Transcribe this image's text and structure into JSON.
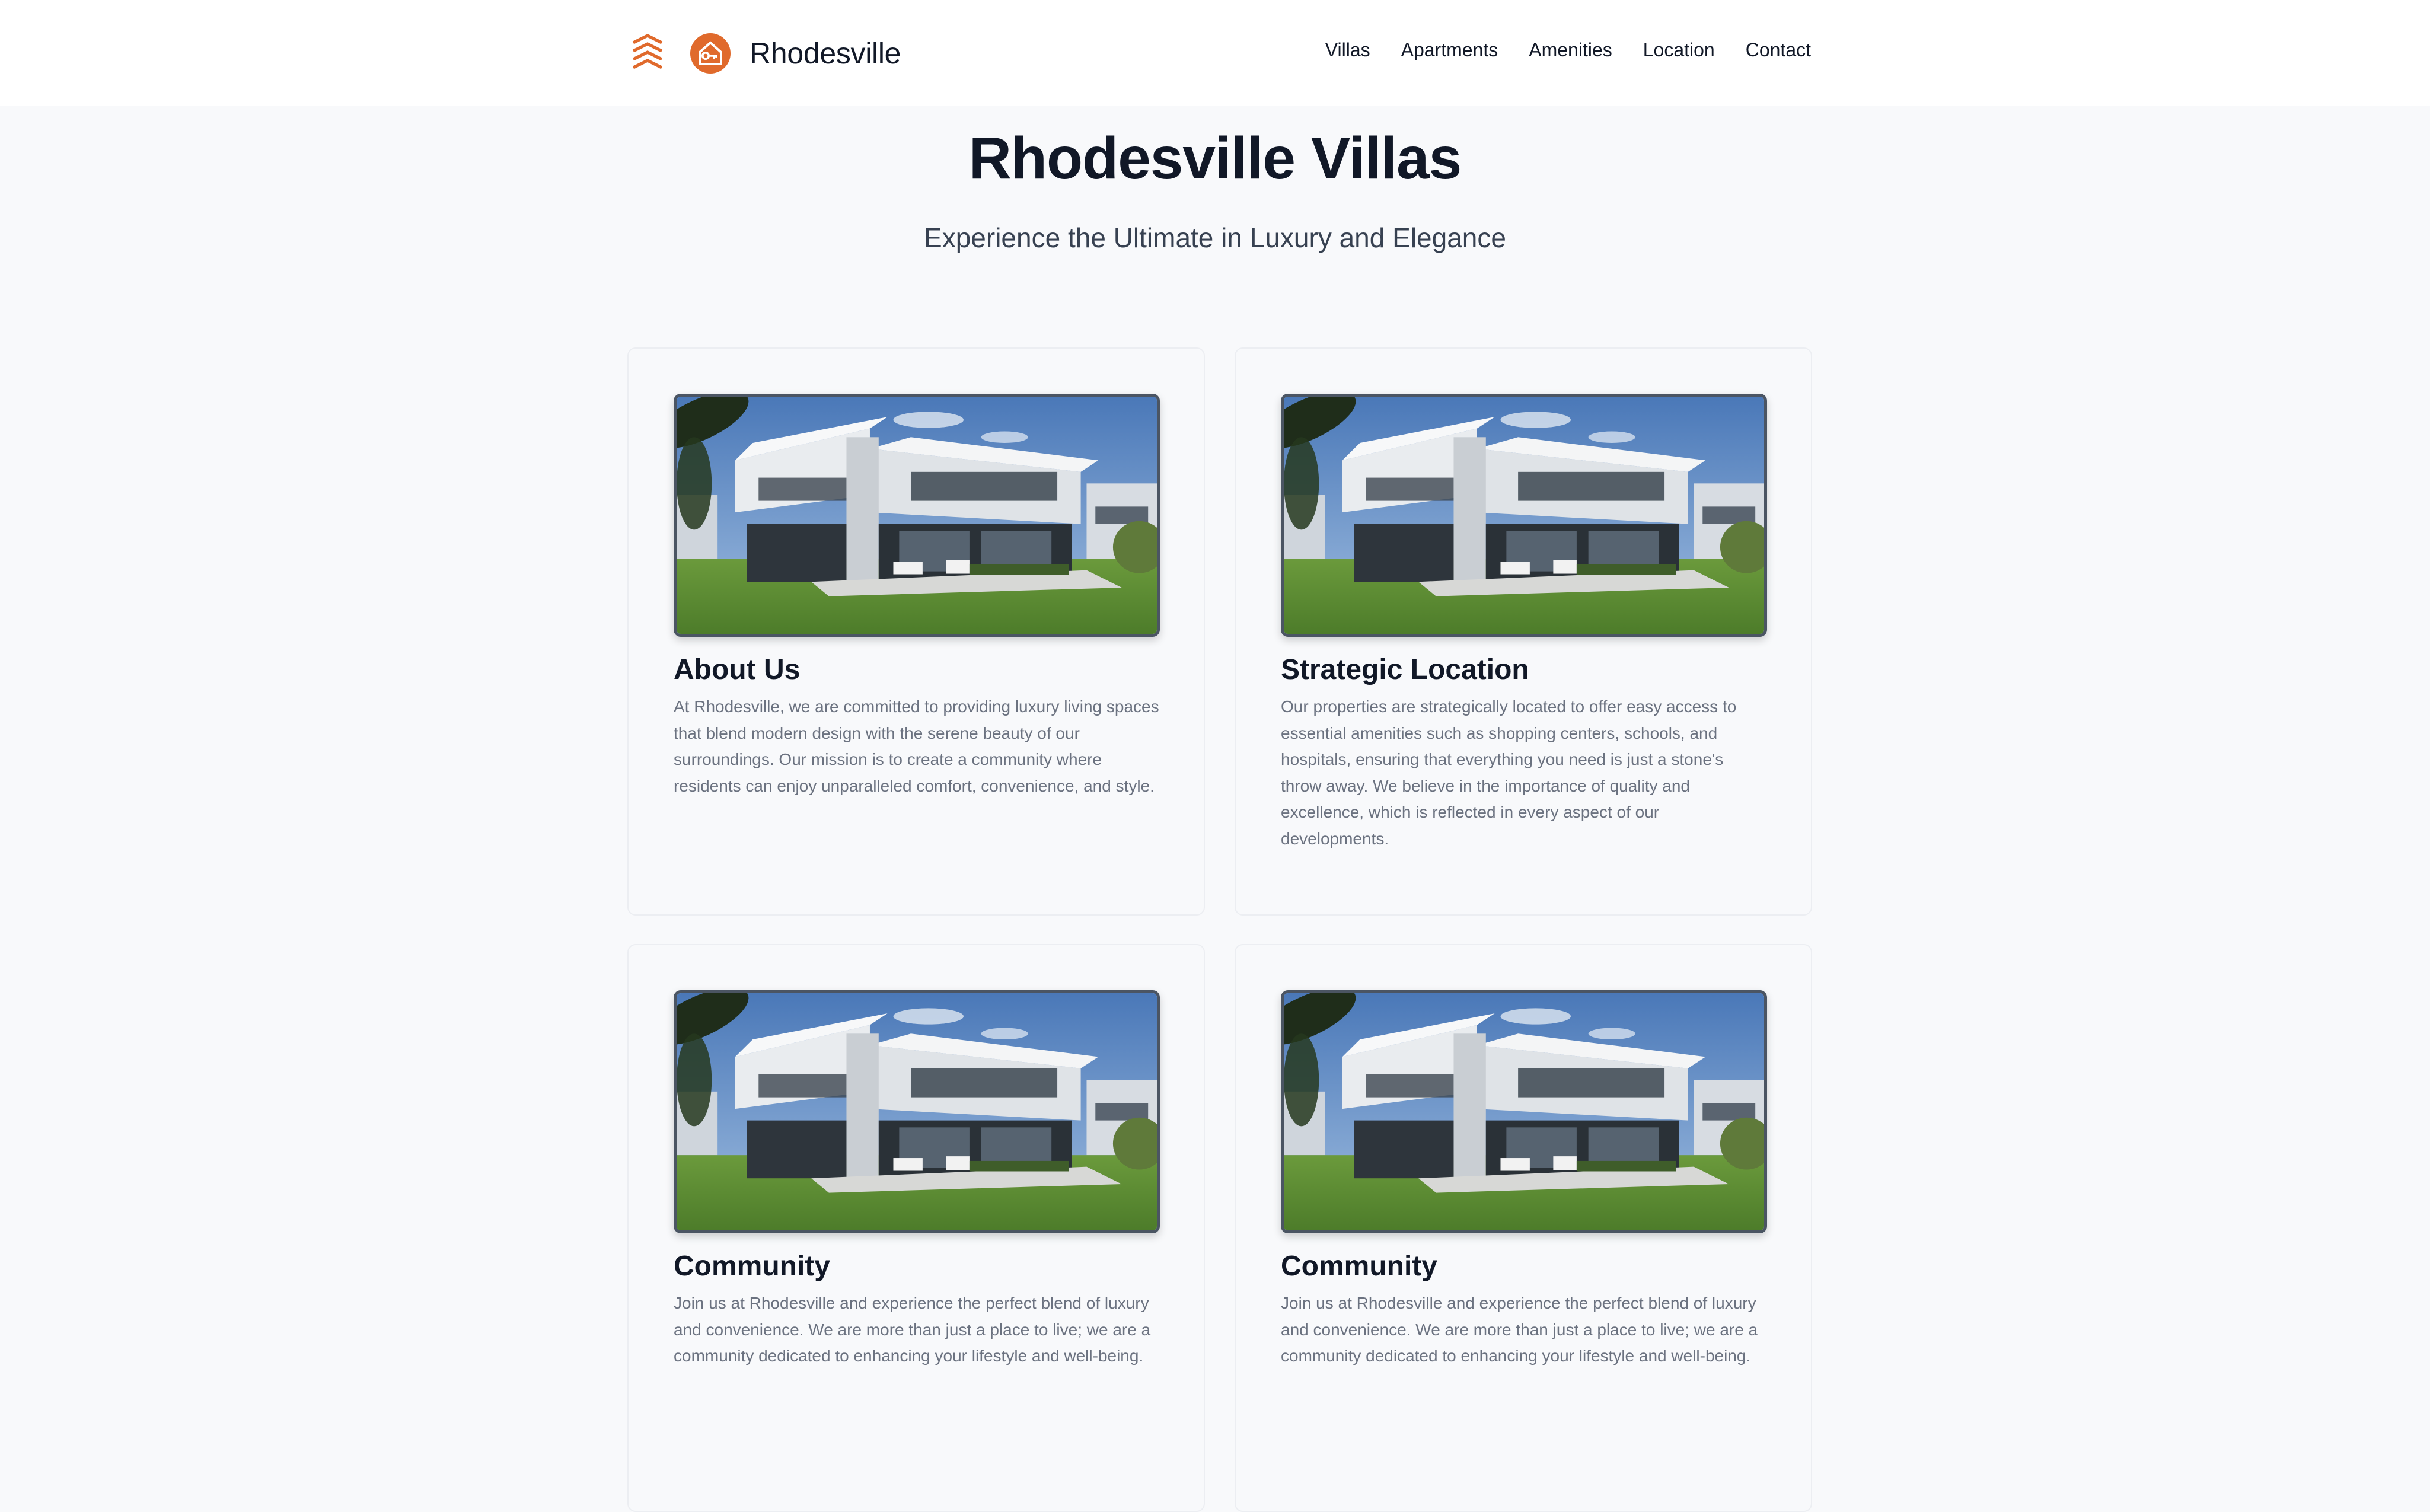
{
  "header": {
    "brand_name": "Rhodesville",
    "logo_icons": [
      "stacked-chevrons-icon",
      "house-key-badge-icon"
    ],
    "nav": [
      "Villas",
      "Apartments",
      "Amenities",
      "Location",
      "Contact"
    ]
  },
  "hero": {
    "title": "Rhodesville Villas",
    "subtitle": "Experience the Ultimate in Luxury and Elegance"
  },
  "cards": [
    {
      "title": "About Us",
      "body": "At Rhodesville, we are committed to providing luxury living spaces that blend modern design with the serene beauty of our surroundings. Our mission is to create a community where residents can enjoy unparalleled comfort, convenience, and style."
    },
    {
      "title": "Strategic Location",
      "body": "Our properties are strategically located to offer easy access to essential amenities such as shopping centers, schools, and hospitals, ensuring that everything you need is just a stone's throw away. We believe in the importance of quality and excellence, which is reflected in every aspect of our developments."
    },
    {
      "title": "Community",
      "body": "Join us at Rhodesville and experience the perfect blend of luxury and convenience. We are more than just a place to live; we are a community dedicated to enhancing your lifestyle and well-being."
    },
    {
      "title": "Community",
      "body": "Join us at Rhodesville and experience the perfect blend of luxury and convenience. We are more than just a place to live; we are a community dedicated to enhancing your lifestyle and well-being."
    }
  ],
  "colors": {
    "brand_orange": "#e06a2c",
    "page_background": "#f8f9fb",
    "header_background": "#ffffff",
    "heading_text": "#111827",
    "body_text": "#6b7280"
  }
}
